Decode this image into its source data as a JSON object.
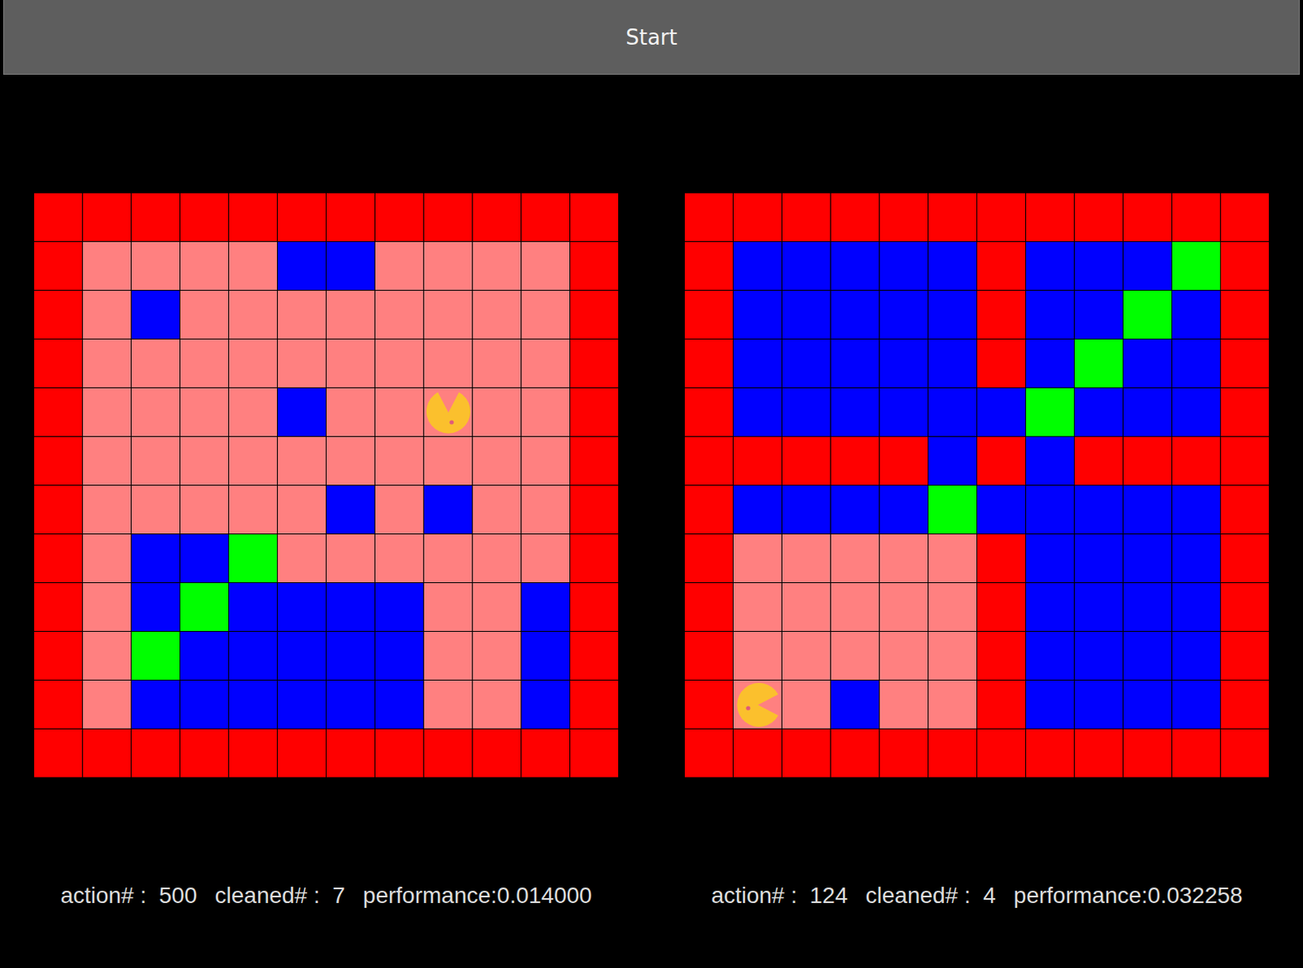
{
  "toolbar": {
    "button": "Start"
  },
  "worlds": [
    {
      "rows": [
        "WWWWWWWWWWWW",
        "WPPPPBBPPPPW",
        "WPBPPPPPPPPW",
        "WPPPPPPPPPPW",
        "WPPPPBPPPPPW",
        "WPPPPPPPPPPW",
        "WPPPPPBPBPPW",
        "WPBBGPPPPPPW",
        "WPBGBBBBPPBW",
        "WPGBBBBBPPBW",
        "WPBBBBBBPPBW",
        "WWWWWWWWWWWW"
      ],
      "agent": {
        "row": 4,
        "col": 8,
        "facing": "up"
      },
      "stats": [
        "action# :  500",
        "cleaned# :  7",
        "performance:0.014000"
      ]
    },
    {
      "rows": [
        "WWWWWWWWWWWW",
        "WBBBBBWBBBGW",
        "WBBBBBWBBGBW",
        "WBBBBBWBGBBW",
        "WBBBBBBGBBBW",
        "WWWWWBWBWWWW",
        "WBBBBGBBBBBW",
        "WPPPPPWBBBBW",
        "WPPPPPWBBBBW",
        "WPPPPPWBBBBW",
        "WPPBPPWBBBBW",
        "WWWWWWWWWWWW"
      ],
      "agent": {
        "row": 10,
        "col": 1,
        "facing": "right"
      },
      "stats": [
        "action# :  124",
        "cleaned# :  4",
        "performance:0.032258"
      ]
    }
  ]
}
